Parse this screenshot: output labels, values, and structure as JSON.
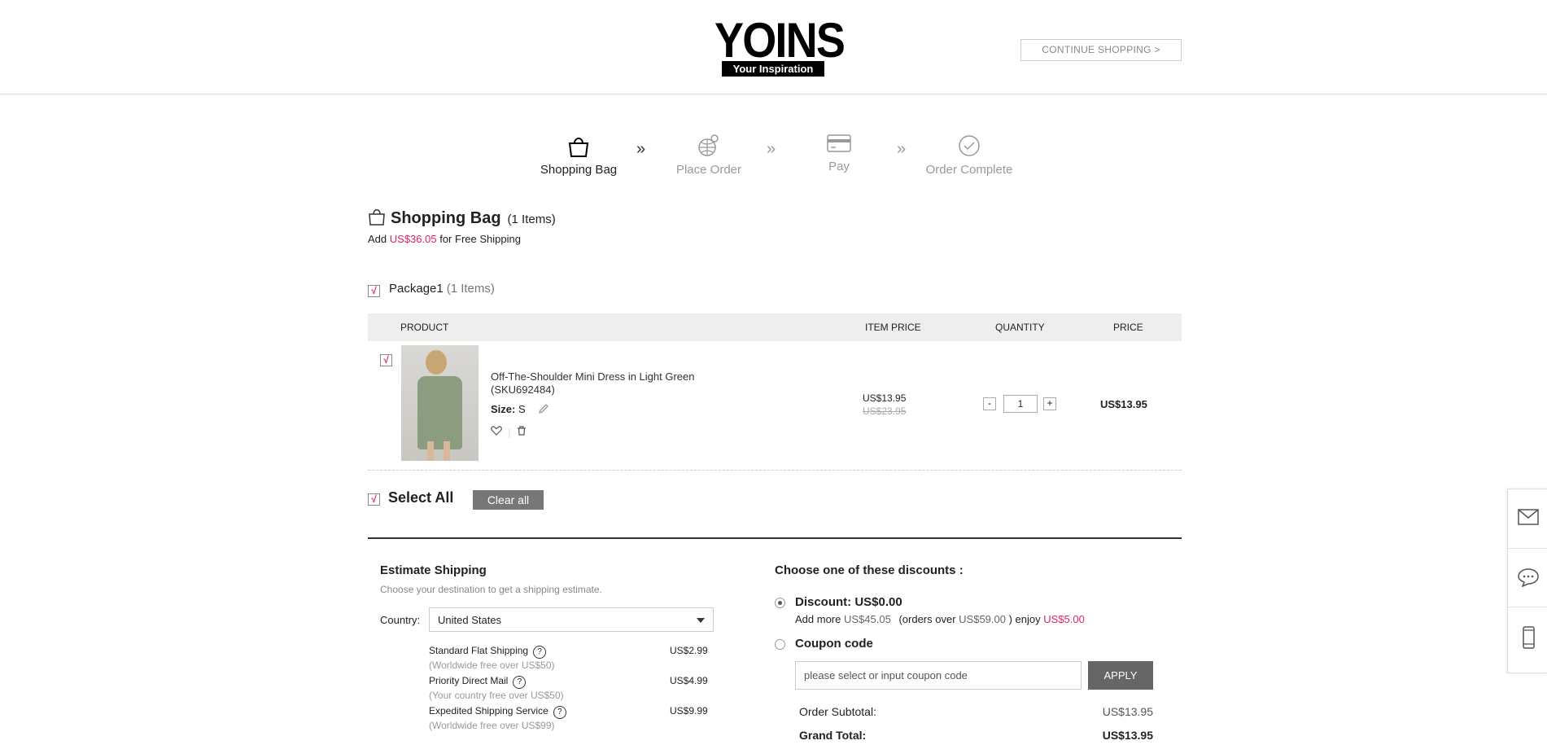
{
  "header": {
    "logo_text": "YOINS",
    "logo_tagline": "Your Inspiration",
    "continue_label": "CONTINUE SHOPPING >"
  },
  "steps": [
    {
      "label": "Shopping Bag",
      "icon": "bag-icon",
      "active": true
    },
    {
      "label": "Place Order",
      "icon": "globe-pin-icon",
      "active": false
    },
    {
      "label": "Pay",
      "icon": "credit-card-icon",
      "active": false
    },
    {
      "label": "Order Complete",
      "icon": "check-circle-icon",
      "active": false
    }
  ],
  "bag": {
    "title": "Shopping Bag",
    "count": "(1 Items)",
    "free_ship_prefix": "Add",
    "free_ship_amount": "US$36.05",
    "free_ship_suffix": "for Free Shipping"
  },
  "package": {
    "label": "Package1",
    "count": "(1 Items)"
  },
  "table": {
    "headers": {
      "product": "PRODUCT",
      "item_price": "ITEM PRICE",
      "quantity": "QUANTITY",
      "price": "PRICE"
    },
    "items": [
      {
        "name": "Off-The-Shoulder Mini Dress in Light Green",
        "sku": "(SKU692484)",
        "size_label": "Size:",
        "size_value": "S",
        "item_price": "US$13.95",
        "original_price": "US$23.95",
        "quantity": "1",
        "price": "US$13.95"
      }
    ]
  },
  "select_all_label": "Select All",
  "clear_all_label": "Clear all",
  "shipping": {
    "title": "Estimate Shipping",
    "subtitle": "Choose your destination to get a shipping estimate.",
    "country_label": "Country:",
    "country_value": "United States",
    "options": [
      {
        "name": "Standard Flat Shipping",
        "note": "(Worldwide free over US$50)",
        "price": "US$2.99"
      },
      {
        "name": "Priority Direct Mail",
        "note": "(Your country free over US$50)",
        "price": "US$4.99"
      },
      {
        "name": "Expedited Shipping Service",
        "note": "(Worldwide free over US$99)",
        "price": "US$9.99"
      }
    ]
  },
  "discounts": {
    "title": "Choose one of these discounts :",
    "discount_label": "Discount: US$0.00",
    "note_addmore": "Add more",
    "note_amount": "US$45.05",
    "note_orders": "(orders over",
    "note_threshold": "US$59.00",
    "note_enjoy": ") enjoy",
    "note_reward": "US$5.00",
    "coupon_label": "Coupon code",
    "coupon_placeholder": "please select or input coupon code",
    "apply_label": "APPLY"
  },
  "summary": {
    "subtotal_label": "Order Subtotal:",
    "subtotal_value": "US$13.95",
    "grand_label": "Grand Total:",
    "grand_value": "US$13.95"
  },
  "colors": {
    "accent": "#e0245e",
    "button_dark": "#666666",
    "button_grey": "#777777"
  },
  "side_icons": [
    "mail-icon",
    "chat-icon",
    "phone-icon"
  ]
}
